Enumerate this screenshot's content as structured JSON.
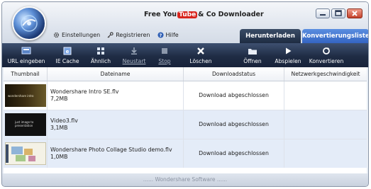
{
  "app": {
    "title_prefix": "Free You",
    "title_brand": "Tube",
    "title_suffix": "& Co Downloader"
  },
  "menu": [
    {
      "label": "Einstellungen",
      "icon": "gear-icon"
    },
    {
      "label": "Registrieren",
      "icon": "key-icon"
    },
    {
      "label": "Hilfe",
      "icon": "help-icon"
    }
  ],
  "tabs": {
    "download": "Herunterladen",
    "convert": "Konvertierungsliste"
  },
  "toolbar": [
    {
      "label": "URL eingeben",
      "icon": "url-icon",
      "enabled": true
    },
    {
      "label": "IE Cache",
      "icon": "ie-cache-icon",
      "enabled": true
    },
    {
      "label": "Ähnlich",
      "icon": "similar-icon",
      "enabled": true
    },
    {
      "label": "Neustart",
      "icon": "restart-icon",
      "enabled": false
    },
    {
      "label": "Stop",
      "icon": "stop-icon",
      "enabled": false
    },
    {
      "label": "Löschen",
      "icon": "delete-icon",
      "enabled": true
    },
    {
      "label": "Öffnen",
      "icon": "folder-icon",
      "enabled": true
    },
    {
      "label": "Abspielen",
      "icon": "play-icon",
      "enabled": true
    },
    {
      "label": "Konvertieren",
      "icon": "convert-icon",
      "enabled": true
    }
  ],
  "table": {
    "columns": [
      "Thumbnail",
      "Dateiname",
      "Downloadstatus",
      "Netzwerkgeschwindigkeit"
    ],
    "rows": [
      {
        "name": "Wondershare Intro SE.flv",
        "size": "7,2MB",
        "status": "Download abgeschlossen",
        "speed": ""
      },
      {
        "name": "Video3.flv",
        "size": "3,1MB",
        "status": "Download abgeschlossen",
        "speed": ""
      },
      {
        "name": "Wondershare Photo Collage Studio demo.flv",
        "size": "1,0MB",
        "status": "Download abgeschlossen",
        "speed": ""
      }
    ]
  },
  "footer": {
    "text": "...... Wondershare Software ......"
  }
}
